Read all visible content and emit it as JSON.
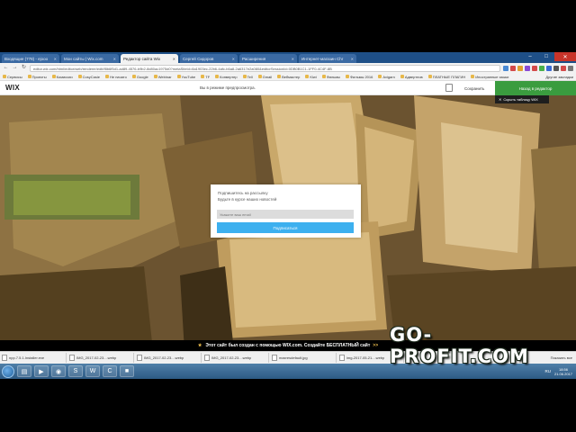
{
  "browser": {
    "tabs": [
      {
        "label": "Входящие (778) - ejooo",
        "active": false
      },
      {
        "label": "Мои сайты | Wix.com",
        "active": false
      },
      {
        "label": "Редактор сайта Wix",
        "active": true
      },
      {
        "label": "Сергей Сидоров",
        "active": false
      },
      {
        "label": "Расширения",
        "active": false
      },
      {
        "label": "Интернет-магазин Chr",
        "active": false
      }
    ],
    "url": "editor.wix.com/html/editor/web/renderer/edit/f8b6f5d1-ad89-4576-b9b2-8d80ac1975d0?metaSiteId=8a1903ec-22b6-4afc-b6a8-2a6317e2a080&editorSessionId=0DB0B1C1-1FF0-4C4F-8B",
    "bookmarks": [
      "Сервисы",
      "Проекты",
      "Комиссии",
      "CosyCasie",
      "Не начато",
      "Google",
      "Webinar",
      "YouTube",
      "TF",
      "Конвертер",
      "Tell",
      "Gmail",
      "Вебмастер",
      "Kiwi",
      "Фильмы",
      "Фильмы 2016",
      "Avigarn",
      "Адвертнов",
      "ПЛАТНЫЕ ПЛАГИН",
      "Иностранные языки"
    ],
    "bookmarks_other": "Другие закладки"
  },
  "wix": {
    "logo": "WIX",
    "preview_note": "Вы в режиме предпросмотра.",
    "save_label": "Сохранить",
    "back_to_editor_label": "Назад в редактор",
    "hide_label": "Скрыть таблицу WIX"
  },
  "popup": {
    "line1": "Подпишитесь на рассылку",
    "line2": "Будьте в курсе наших новостей",
    "input_placeholder": "Укажите ваш email",
    "button_label": "Подписаться"
  },
  "wix_banner": {
    "text": "Этот сайт был создан с помощью WIX.com. Создайте БЕСПЛАТНЫЙ сайт",
    "arrows": ">>"
  },
  "downloads": {
    "items": [
      "npp.7.5.1.Installer.exe",
      "IMG_2017-02-23....webp",
      "IMG_2017-02-23....webp",
      "IMG_2017-02-23....webp",
      "maxresdefault.jpg",
      "img-2017-05-21....webp"
    ],
    "show_all": "Показать все"
  },
  "taskbar": {
    "lang": "RU",
    "time": "18:56",
    "date": "21.06.2017"
  },
  "watermark": "GO-PROFIT.COM",
  "colors": {
    "tab_strip": "#1e4f87",
    "popup_button": "#3db0ef",
    "editor_green": "#3a9c3f"
  }
}
